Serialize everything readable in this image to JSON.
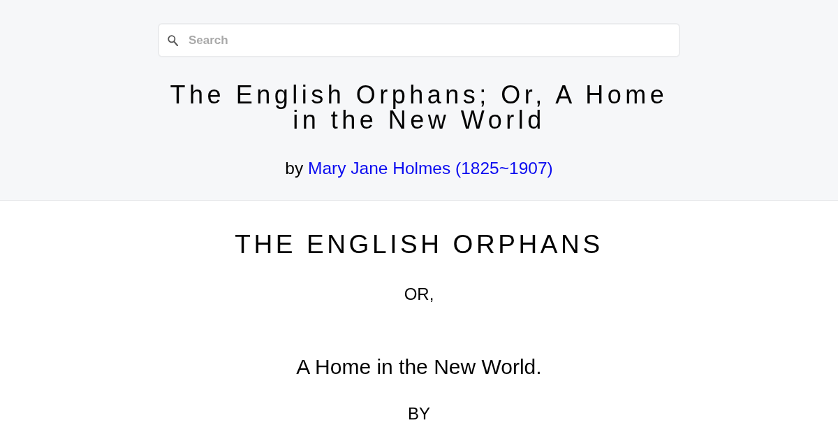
{
  "search": {
    "placeholder": "Search"
  },
  "header": {
    "title": "The English Orphans; Or, A Home in the New World",
    "byline_prefix": "by",
    "author_link": "Mary Jane Holmes (1825~1907)"
  },
  "content": [
    {
      "kind": "heading",
      "text": "THE ENGLISH ORPHANS"
    },
    {
      "kind": "line",
      "text": "OR,"
    },
    {
      "kind": "subtitle",
      "text": "A Home in the New World."
    },
    {
      "kind": "line",
      "text": "BY"
    }
  ]
}
